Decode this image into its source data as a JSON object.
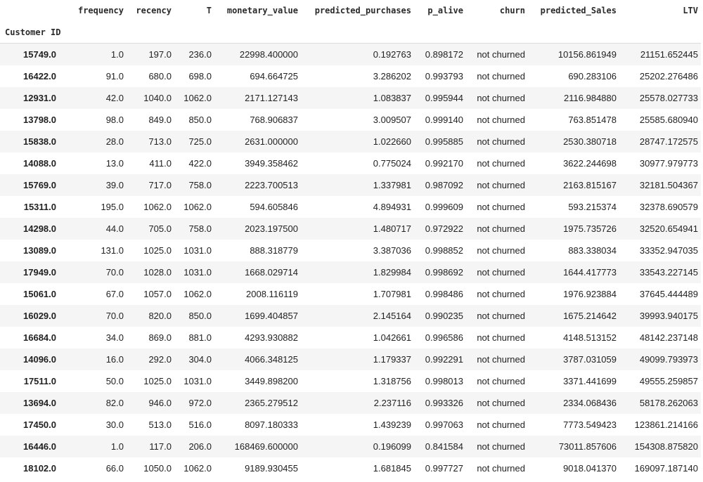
{
  "index_name": "Customer ID",
  "columns": [
    "frequency",
    "recency",
    "T",
    "monetary_value",
    "predicted_purchases",
    "p_alive",
    "churn",
    "predicted_Sales",
    "LTV"
  ],
  "rows": [
    {
      "id": "15749.0",
      "cells": [
        "1.0",
        "197.0",
        "236.0",
        "22998.400000",
        "0.192763",
        "0.898172",
        "not churned",
        "10156.861949",
        "21151.652445"
      ]
    },
    {
      "id": "16422.0",
      "cells": [
        "91.0",
        "680.0",
        "698.0",
        "694.664725",
        "3.286202",
        "0.993793",
        "not churned",
        "690.283106",
        "25202.276486"
      ]
    },
    {
      "id": "12931.0",
      "cells": [
        "42.0",
        "1040.0",
        "1062.0",
        "2171.127143",
        "1.083837",
        "0.995944",
        "not churned",
        "2116.984880",
        "25578.027733"
      ]
    },
    {
      "id": "13798.0",
      "cells": [
        "98.0",
        "849.0",
        "850.0",
        "768.906837",
        "3.009507",
        "0.999140",
        "not churned",
        "763.851478",
        "25585.680940"
      ]
    },
    {
      "id": "15838.0",
      "cells": [
        "28.0",
        "713.0",
        "725.0",
        "2631.000000",
        "1.022660",
        "0.995885",
        "not churned",
        "2530.380718",
        "28747.172575"
      ]
    },
    {
      "id": "14088.0",
      "cells": [
        "13.0",
        "411.0",
        "422.0",
        "3949.358462",
        "0.775024",
        "0.992170",
        "not churned",
        "3622.244698",
        "30977.979773"
      ]
    },
    {
      "id": "15769.0",
      "cells": [
        "39.0",
        "717.0",
        "758.0",
        "2223.700513",
        "1.337981",
        "0.987092",
        "not churned",
        "2163.815167",
        "32181.504367"
      ]
    },
    {
      "id": "15311.0",
      "cells": [
        "195.0",
        "1062.0",
        "1062.0",
        "594.605846",
        "4.894931",
        "0.999609",
        "not churned",
        "593.215374",
        "32378.690579"
      ]
    },
    {
      "id": "14298.0",
      "cells": [
        "44.0",
        "705.0",
        "758.0",
        "2023.197500",
        "1.480717",
        "0.972922",
        "not churned",
        "1975.735726",
        "32520.654941"
      ]
    },
    {
      "id": "13089.0",
      "cells": [
        "131.0",
        "1025.0",
        "1031.0",
        "888.318779",
        "3.387036",
        "0.998852",
        "not churned",
        "883.338034",
        "33352.947035"
      ]
    },
    {
      "id": "17949.0",
      "cells": [
        "70.0",
        "1028.0",
        "1031.0",
        "1668.029714",
        "1.829984",
        "0.998692",
        "not churned",
        "1644.417773",
        "33543.227145"
      ]
    },
    {
      "id": "15061.0",
      "cells": [
        "67.0",
        "1057.0",
        "1062.0",
        "2008.116119",
        "1.707981",
        "0.998486",
        "not churned",
        "1976.923884",
        "37645.444489"
      ]
    },
    {
      "id": "16029.0",
      "cells": [
        "70.0",
        "820.0",
        "850.0",
        "1699.404857",
        "2.145164",
        "0.990235",
        "not churned",
        "1675.214642",
        "39993.940175"
      ]
    },
    {
      "id": "16684.0",
      "cells": [
        "34.0",
        "869.0",
        "881.0",
        "4293.930882",
        "1.042661",
        "0.996586",
        "not churned",
        "4148.513152",
        "48142.237148"
      ]
    },
    {
      "id": "14096.0",
      "cells": [
        "16.0",
        "292.0",
        "304.0",
        "4066.348125",
        "1.179337",
        "0.992291",
        "not churned",
        "3787.031059",
        "49099.793973"
      ]
    },
    {
      "id": "17511.0",
      "cells": [
        "50.0",
        "1025.0",
        "1031.0",
        "3449.898200",
        "1.318756",
        "0.998013",
        "not churned",
        "3371.441699",
        "49555.259857"
      ]
    },
    {
      "id": "13694.0",
      "cells": [
        "82.0",
        "946.0",
        "972.0",
        "2365.279512",
        "2.237116",
        "0.993326",
        "not churned",
        "2334.068436",
        "58178.262063"
      ]
    },
    {
      "id": "17450.0",
      "cells": [
        "30.0",
        "513.0",
        "516.0",
        "8097.180333",
        "1.439239",
        "0.997063",
        "not churned",
        "7773.549423",
        "123861.214166"
      ]
    },
    {
      "id": "16446.0",
      "cells": [
        "1.0",
        "117.0",
        "206.0",
        "168469.600000",
        "0.196099",
        "0.841584",
        "not churned",
        "73011.857606",
        "154308.875820"
      ]
    },
    {
      "id": "18102.0",
      "cells": [
        "66.0",
        "1050.0",
        "1062.0",
        "9189.930455",
        "1.681845",
        "0.997727",
        "not churned",
        "9018.041370",
        "169097.187140"
      ]
    }
  ]
}
